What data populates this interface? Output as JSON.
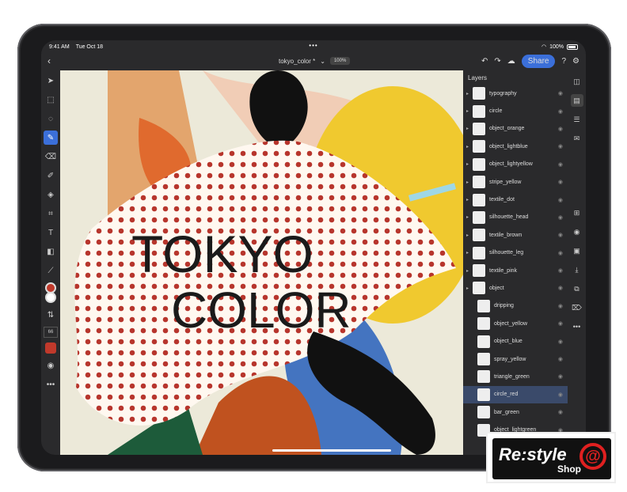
{
  "status": {
    "time": "9:41 AM",
    "date": "Tue Oct 18",
    "battery": "100%"
  },
  "topbar": {
    "doc_title": "tokyo_color *",
    "zoom": "100%",
    "share_label": "Share"
  },
  "artwork": {
    "line1": "TOKYO",
    "line2": "COLOR"
  },
  "tools": {
    "brush_size": "66"
  },
  "layers": {
    "title": "Layers",
    "items": [
      {
        "name": "typography",
        "child": false,
        "selected": false
      },
      {
        "name": "circle",
        "child": false,
        "selected": false
      },
      {
        "name": "object_orange",
        "child": false,
        "selected": false
      },
      {
        "name": "object_lightblue",
        "child": false,
        "selected": false
      },
      {
        "name": "object_lightyellow",
        "child": false,
        "selected": false
      },
      {
        "name": "stripe_yellow",
        "child": false,
        "selected": false
      },
      {
        "name": "textile_dot",
        "child": false,
        "selected": false
      },
      {
        "name": "silhouette_head",
        "child": false,
        "selected": false
      },
      {
        "name": "textile_brown",
        "child": false,
        "selected": false
      },
      {
        "name": "silhouette_leg",
        "child": false,
        "selected": false
      },
      {
        "name": "textile_pink",
        "child": false,
        "selected": false
      },
      {
        "name": "object",
        "child": false,
        "selected": false
      },
      {
        "name": "dripping",
        "child": true,
        "selected": false
      },
      {
        "name": "object_yellow",
        "child": true,
        "selected": false
      },
      {
        "name": "object_blue",
        "child": true,
        "selected": false
      },
      {
        "name": "spray_yellow",
        "child": true,
        "selected": false
      },
      {
        "name": "triangle_green",
        "child": true,
        "selected": false
      },
      {
        "name": "circle_red",
        "child": true,
        "selected": true
      },
      {
        "name": "bar_green",
        "child": true,
        "selected": false
      },
      {
        "name": "object_lightgreen",
        "child": true,
        "selected": false
      }
    ]
  },
  "logo": {
    "main": "Re:style",
    "sub": "Shop",
    "at": "@"
  },
  "colors": {
    "accent": "#3b6fd9",
    "primary_color": "#c0392b",
    "secondary_color": "#ffffff"
  }
}
